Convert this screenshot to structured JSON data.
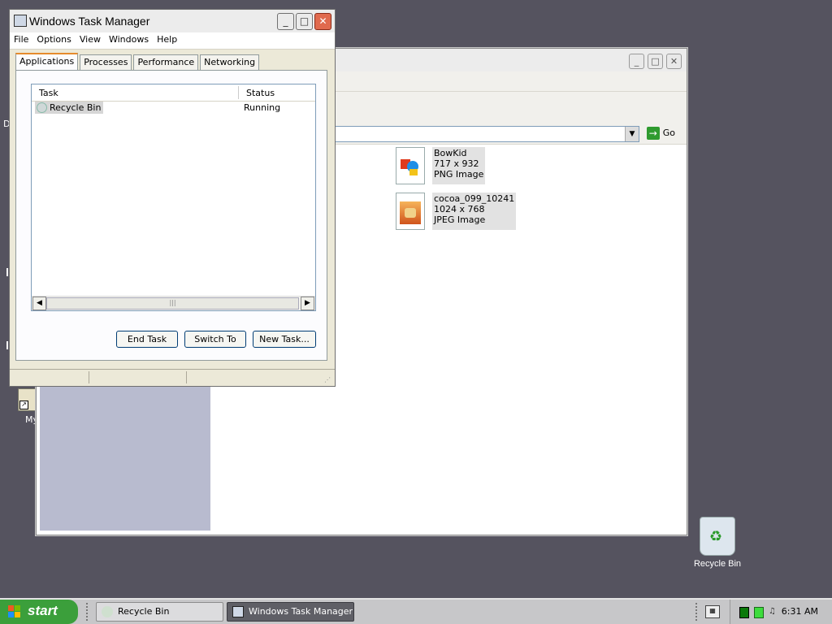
{
  "explorer": {
    "go_label": "Go",
    "files": [
      {
        "name": "BowKid",
        "dims": "717 x 932",
        "type": "PNG Image"
      },
      {
        "name": "cocoa_099_10241",
        "dims": "1024 x 768",
        "type": "JPEG Image"
      }
    ]
  },
  "taskmanager": {
    "title": "Windows Task Manager",
    "menu": [
      "File",
      "Options",
      "View",
      "Windows",
      "Help"
    ],
    "tabs": [
      "Applications",
      "Processes",
      "Performance",
      "Networking"
    ],
    "columns": {
      "task": "Task",
      "status": "Status"
    },
    "rows": [
      {
        "task": "Recycle Bin",
        "status": "Running"
      }
    ],
    "buttons": {
      "end_task": "End Task",
      "switch_to": "Switch To",
      "new_task": "New Task..."
    }
  },
  "desktop": {
    "recycle_bin_label": "Recycle Bin",
    "partial_labels": [
      "D",
      "My"
    ]
  },
  "taskbar": {
    "start_label": "start",
    "buttons": [
      "Recycle Bin",
      "Windows Task Manager"
    ],
    "clock": "6:31 AM"
  }
}
